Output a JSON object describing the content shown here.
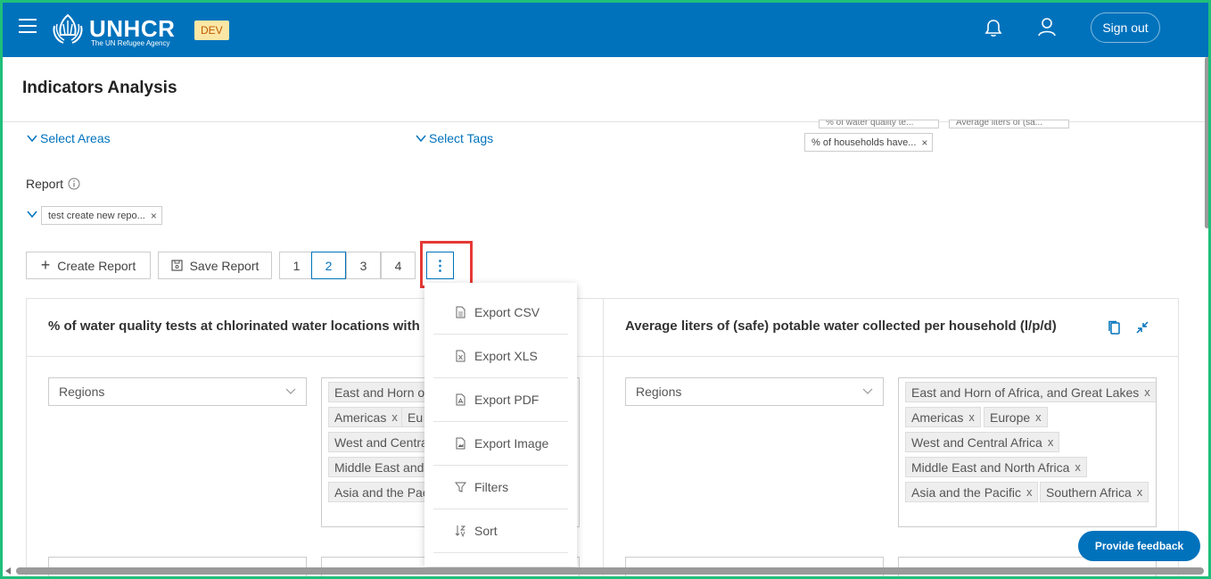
{
  "header": {
    "brand": "UNHCR",
    "brand_sub": "The UN Refugee Agency",
    "env_badge": "DEV",
    "sign_out": "Sign out"
  },
  "page_title": "Indicators Analysis",
  "filters": {
    "select_areas": "Select Areas",
    "select_tags": "Select Tags",
    "indicator_chips_top": [
      "% of water quality te...",
      "Average liters of (sa..."
    ],
    "indicator_chip": "% of households have..."
  },
  "report": {
    "label": "Report",
    "selected": "test create new repo..."
  },
  "toolbar": {
    "create_report": "Create Report",
    "save_report": "Save Report",
    "pages": [
      "1",
      "2",
      "3",
      "4"
    ],
    "active_page": "2",
    "more": "⋮"
  },
  "menu": {
    "items": [
      "Export CSV",
      "Export XLS",
      "Export PDF",
      "Export Image",
      "Filters",
      "Sort"
    ]
  },
  "cards": [
    {
      "title": "% of water quality tests at chlorinated water locations with",
      "dropdown": "Regions",
      "tags": [
        "East and Horn of",
        "Americas",
        "Eu",
        "West and Centra",
        "Middle East and",
        "Asia and the Pac"
      ]
    },
    {
      "title": "Average liters of (safe) potable water collected per household (l/p/d)",
      "dropdown": "Regions",
      "tags": [
        "East and Horn of Africa, and Great Lakes",
        "Americas",
        "Europe",
        "West and Central Africa",
        "Middle East and North Africa",
        "Asia and the Pacific",
        "Southern Africa"
      ]
    }
  ],
  "feedback_button": "Provide feedback",
  "colors": {
    "brand_blue": "#0072bc",
    "badge_bg": "#fbe7a5",
    "badge_text": "#c05a00",
    "highlight_red": "#e53935",
    "frame_green": "#1fbf7a"
  }
}
